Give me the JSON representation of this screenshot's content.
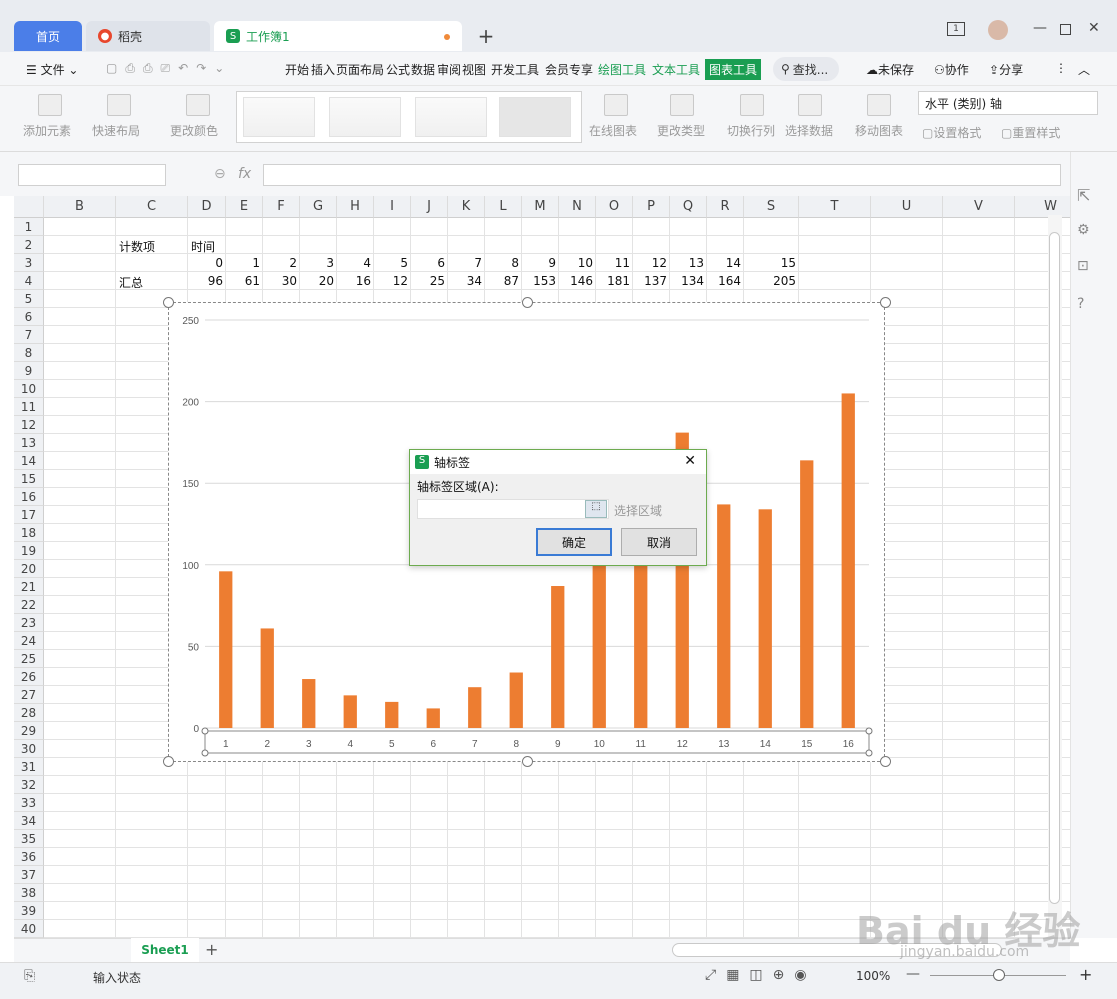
{
  "tabs": {
    "home": "首页",
    "daoke": "稻壳",
    "workbook": "工作簿1",
    "badge": "1"
  },
  "menu": {
    "file": "文件",
    "items": [
      "开始",
      "插入",
      "页面布局",
      "公式",
      "数据",
      "审阅",
      "视图",
      "开发工具",
      "会员专享"
    ],
    "draw_tools": "绘图工具",
    "text_tools": "文本工具",
    "chart_tools": "图表工具",
    "search": "查找...",
    "unsaved": "未保存",
    "collab": "协作",
    "share": "分享"
  },
  "ribbon": {
    "add_element": "添加元素",
    "quick_layout": "快速布局",
    "change_color": "更改颜色",
    "online_chart": "在线图表",
    "change_type": "更改类型",
    "switch_rowcol": "切换行列",
    "select_data": "选择数据",
    "move_chart": "移动图表",
    "axis_select": "水平 (类别) 轴",
    "set_format": "设置格式",
    "reset_style": "重置样式"
  },
  "formula": {
    "fx": "fx",
    "value": ""
  },
  "columns": [
    "B",
    "C",
    "D",
    "E",
    "F",
    "G",
    "H",
    "I",
    "J",
    "K",
    "L",
    "M",
    "N",
    "O",
    "P",
    "Q",
    "R",
    "S",
    "T",
    "U",
    "V",
    "W"
  ],
  "rows": [
    "1",
    "2",
    "3",
    "4",
    "5",
    "6",
    "7",
    "8",
    "9",
    "10",
    "11",
    "12",
    "13",
    "14",
    "15",
    "16",
    "17",
    "18",
    "19",
    "20",
    "21",
    "22",
    "23",
    "24",
    "25",
    "26",
    "27",
    "28",
    "29",
    "30",
    "31",
    "32",
    "33",
    "34",
    "35",
    "36",
    "37",
    "38",
    "39",
    "40"
  ],
  "cells": {
    "c2": "计数项",
    "d2": "时间",
    "c4": "汇总",
    "row3": [
      "0",
      "1",
      "2",
      "3",
      "4",
      "5",
      "6",
      "7",
      "8",
      "9",
      "10",
      "11",
      "12",
      "13",
      "14",
      "15"
    ],
    "row4": [
      "96",
      "61",
      "30",
      "20",
      "16",
      "12",
      "25",
      "34",
      "87",
      "153",
      "146",
      "181",
      "137",
      "134",
      "164",
      "205"
    ]
  },
  "chart_data": {
    "type": "bar",
    "categories": [
      "1",
      "2",
      "3",
      "4",
      "5",
      "6",
      "7",
      "8",
      "9",
      "10",
      "11",
      "12",
      "13",
      "14",
      "15",
      "16"
    ],
    "values": [
      96,
      61,
      30,
      20,
      16,
      12,
      25,
      34,
      87,
      153,
      146,
      181,
      137,
      134,
      164,
      205
    ],
    "yticks": [
      "0",
      "50",
      "100",
      "150",
      "200",
      "250"
    ],
    "ylim": [
      0,
      250
    ],
    "color": "#ed7d31",
    "grid": true
  },
  "dialog": {
    "title": "轴标签",
    "label": "轴标签区域(A):",
    "select_range": "选择区域",
    "ok": "确定",
    "cancel": "取消",
    "input_value": ""
  },
  "sheet": {
    "tab": "Sheet1",
    "add": "+"
  },
  "status": {
    "input_state": "输入状态",
    "zoom": "100%",
    "minus": "—",
    "plus": "+"
  },
  "watermark": {
    "logo": "Bai du 经验",
    "url": "jingyan.baidu.com"
  }
}
